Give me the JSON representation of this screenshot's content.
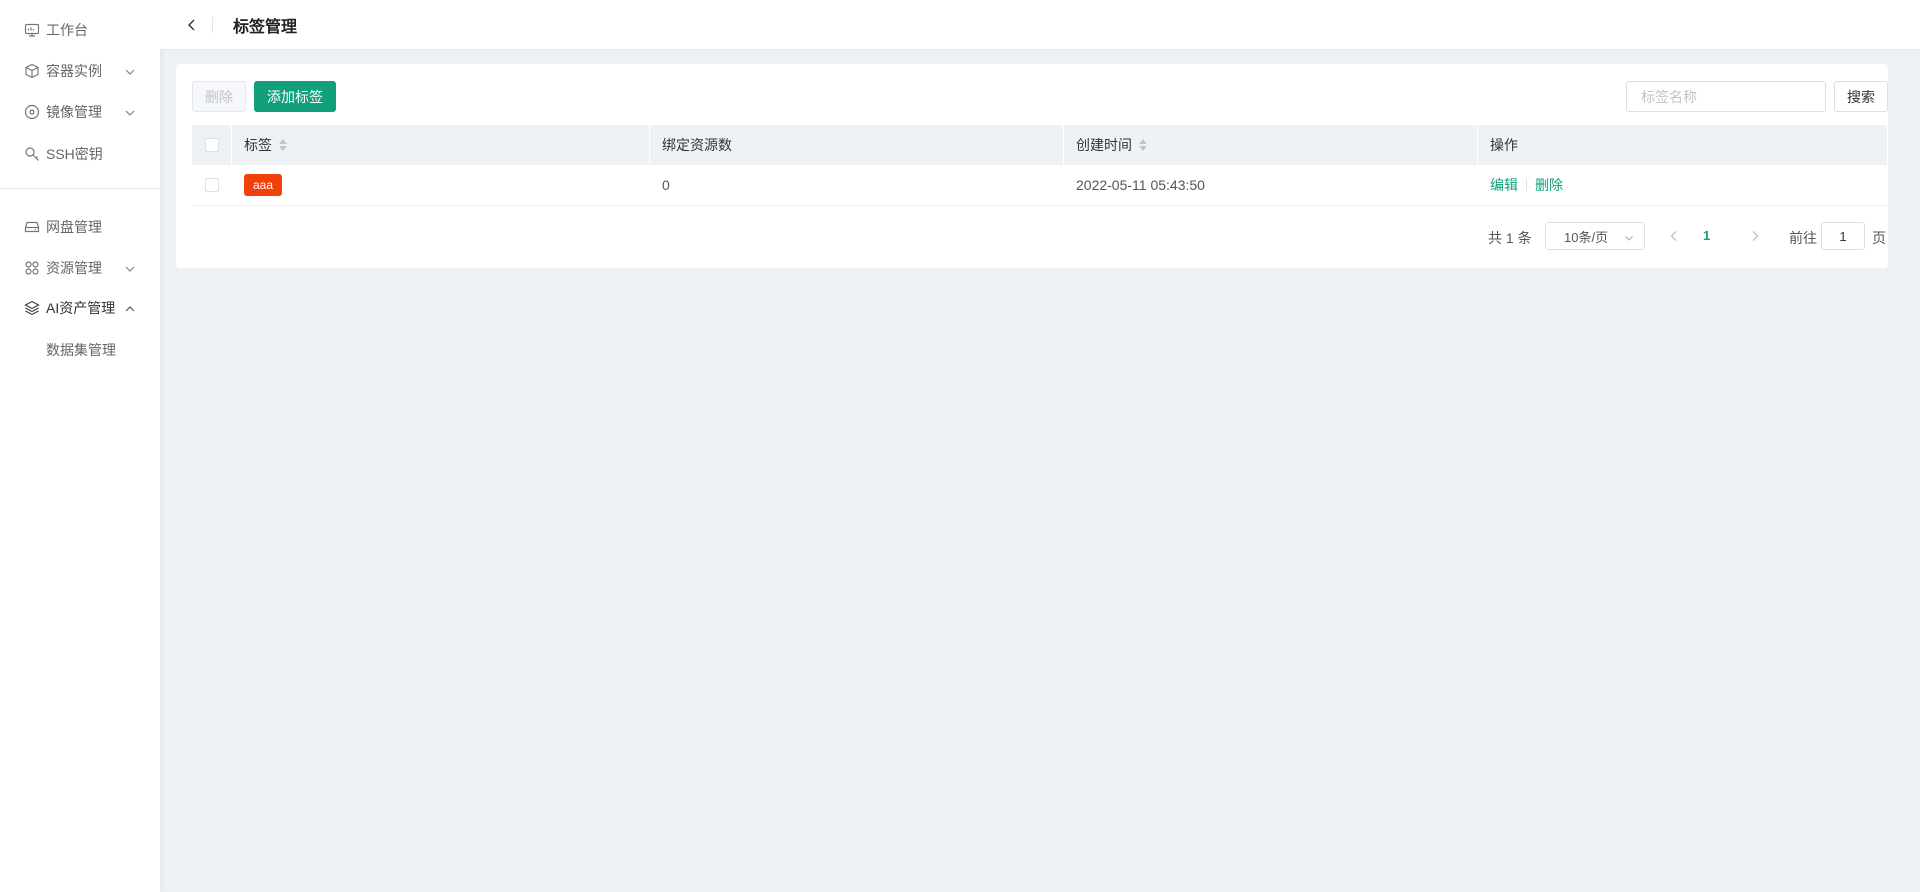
{
  "sidebar": {
    "items": [
      {
        "label": "工作台",
        "icon": "monitor-icon",
        "chevron": ""
      },
      {
        "label": "容器实例",
        "icon": "cube-icon",
        "chevron": "down"
      },
      {
        "label": "镜像管理",
        "icon": "disc-icon",
        "chevron": "down"
      },
      {
        "label": "SSH密钥",
        "icon": "key-icon",
        "chevron": ""
      },
      {
        "label": "网盘管理",
        "icon": "drive-icon",
        "chevron": ""
      },
      {
        "label": "资源管理",
        "icon": "grid-icon",
        "chevron": "down"
      },
      {
        "label": "AI资产管理",
        "icon": "layers-icon",
        "chevron": "up"
      }
    ],
    "subitems": [
      {
        "label": "数据集管理"
      }
    ]
  },
  "header": {
    "title": "标签管理",
    "back_icon": "chevron-left-icon"
  },
  "toolbar": {
    "delete_label": "删除",
    "add_label": "添加标签",
    "search_placeholder": "标签名称",
    "search_value": "",
    "search_label": "搜索"
  },
  "table": {
    "columns": {
      "tag": "标签",
      "resource_count": "绑定资源数",
      "created_at": "创建时间",
      "operations": "操作"
    },
    "rows": [
      {
        "tag": "aaa",
        "tag_color": "#f2400a",
        "resource_count": "0",
        "created_at": "2022-05-11 05:43:50",
        "edit_label": "编辑",
        "delete_label": "删除"
      }
    ]
  },
  "pagination": {
    "total_text": "共 1 条",
    "page_size": "10条/页",
    "current_page": "1",
    "goto_label": "前往",
    "goto_value": "1",
    "goto_unit": "页"
  },
  "colors": {
    "accent": "#11a07b",
    "tag": "#f2400a",
    "background": "#eef2f5"
  }
}
